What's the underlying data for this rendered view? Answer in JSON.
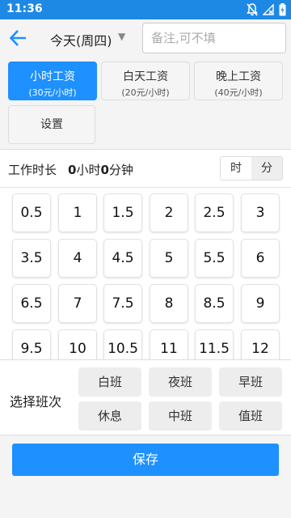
{
  "status_bar": {
    "time": "11:36",
    "icons": [
      "notifications-off-icon",
      "no-signal-icon",
      "battery-charging-icon"
    ]
  },
  "toolbar": {
    "back_icon": "arrow-left-icon",
    "date": "今天(周四)",
    "caret": "▼",
    "note_placeholder": "备注,可不填",
    "note_value": ""
  },
  "wage_options": [
    {
      "title": "小时工资",
      "rate": "(30元/小时)",
      "selected": true
    },
    {
      "title": "白天工资",
      "rate": "(20元/小时)",
      "selected": false
    },
    {
      "title": "晚上工资",
      "rate": "(40元/小时)",
      "selected": false
    }
  ],
  "settings_label": "设置",
  "duration": {
    "label": "工作时长",
    "hours": "0",
    "hours_unit": "小时",
    "minutes": "0",
    "minutes_unit": "分钟",
    "unit_hour": "时",
    "unit_minute": "分",
    "selected_unit": "分"
  },
  "hour_options": [
    "0.5",
    "1",
    "1.5",
    "2",
    "2.5",
    "3",
    "3.5",
    "4",
    "4.5",
    "5",
    "5.5",
    "6",
    "6.5",
    "7",
    "7.5",
    "8",
    "8.5",
    "9",
    "9.5",
    "10",
    "10.5",
    "11",
    "11.5",
    "12"
  ],
  "shift": {
    "label": "选择班次",
    "options": [
      "白班",
      "夜班",
      "早班",
      "休息",
      "中班",
      "值班"
    ]
  },
  "save_label": "保存",
  "colors": {
    "accent": "#1e90ff",
    "status_bar": "#1e88e5"
  }
}
